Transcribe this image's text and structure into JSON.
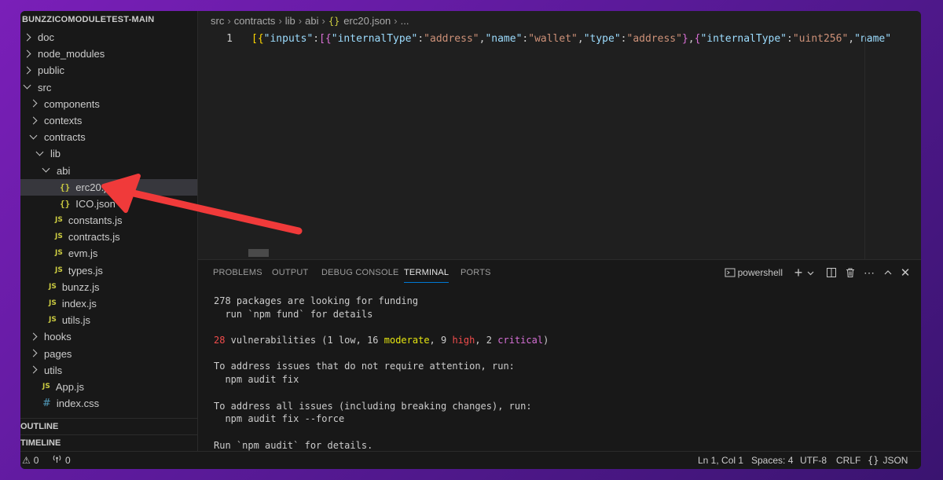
{
  "explorer": {
    "title": "BUNZZICOMODULETEST-MAIN"
  },
  "tree": [
    {
      "label": "doc",
      "type": "folder",
      "state": "collapsed",
      "depth": 0
    },
    {
      "label": "node_modules",
      "type": "folder",
      "state": "collapsed",
      "depth": 0
    },
    {
      "label": "public",
      "type": "folder",
      "state": "collapsed",
      "depth": 0
    },
    {
      "label": "src",
      "type": "folder",
      "state": "expanded",
      "depth": 0
    },
    {
      "label": "components",
      "type": "folder",
      "state": "collapsed",
      "depth": 1
    },
    {
      "label": "contexts",
      "type": "folder",
      "state": "collapsed",
      "depth": 1
    },
    {
      "label": "contracts",
      "type": "folder",
      "state": "expanded",
      "depth": 1
    },
    {
      "label": "lib",
      "type": "folder",
      "state": "expanded",
      "depth": 2
    },
    {
      "label": "abi",
      "type": "folder",
      "state": "expanded",
      "depth": 3
    },
    {
      "label": "erc20.json",
      "type": "json",
      "depth": 4,
      "selected": true
    },
    {
      "label": "ICO.json",
      "type": "json",
      "depth": 4
    },
    {
      "label": "constants.js",
      "type": "js",
      "depth": 3
    },
    {
      "label": "contracts.js",
      "type": "js",
      "depth": 3
    },
    {
      "label": "evm.js",
      "type": "js",
      "depth": 3
    },
    {
      "label": "types.js",
      "type": "js",
      "depth": 3
    },
    {
      "label": "bunzz.js",
      "type": "js",
      "depth": 2
    },
    {
      "label": "index.js",
      "type": "js",
      "depth": 2
    },
    {
      "label": "utils.js",
      "type": "js",
      "depth": 2
    },
    {
      "label": "hooks",
      "type": "folder",
      "state": "collapsed",
      "depth": 1
    },
    {
      "label": "pages",
      "type": "folder",
      "state": "collapsed",
      "depth": 1
    },
    {
      "label": "utils",
      "type": "folder",
      "state": "collapsed",
      "depth": 1
    },
    {
      "label": "App.js",
      "type": "js",
      "depth": 1
    },
    {
      "label": "index.css",
      "type": "css",
      "depth": 1
    }
  ],
  "icons": {
    "js": "JS",
    "json": "{}",
    "css": "#"
  },
  "sections": {
    "outline": "OUTLINE",
    "timeline": "TIMELINE"
  },
  "breadcrumb": {
    "parts": [
      "src",
      "contracts",
      "lib",
      "abi"
    ],
    "file": "erc20.json",
    "more": "..."
  },
  "editor": {
    "line_number": "1",
    "tokens": [
      [
        "br",
        "[{"
      ],
      [
        "key",
        "\"inputs\""
      ],
      [
        "p",
        ":"
      ],
      [
        "br2",
        "[{"
      ],
      [
        "key",
        "\"internalType\""
      ],
      [
        "p",
        ":"
      ],
      [
        "str",
        "\"address\""
      ],
      [
        "p",
        ","
      ],
      [
        "key",
        "\"name\""
      ],
      [
        "p",
        ":"
      ],
      [
        "str",
        "\"wallet\""
      ],
      [
        "p",
        ","
      ],
      [
        "key",
        "\"type\""
      ],
      [
        "p",
        ":"
      ],
      [
        "str",
        "\"address\""
      ],
      [
        "br2",
        "}"
      ],
      [
        "p",
        ","
      ],
      [
        "br2",
        "{"
      ],
      [
        "key",
        "\"internalType\""
      ],
      [
        "p",
        ":"
      ],
      [
        "str",
        "\"uint256\""
      ],
      [
        "p",
        ","
      ],
      [
        "key",
        "\"name\""
      ],
      [
        "p",
        ":"
      ],
      [
        "str",
        "\""
      ]
    ]
  },
  "panel": {
    "tabs": [
      "PROBLEMS",
      "OUTPUT",
      "DEBUG CONSOLE",
      "TERMINAL",
      "PORTS"
    ],
    "active_tab": "TERMINAL",
    "shell": "powershell"
  },
  "terminal": {
    "lines": [
      [
        [
          "n",
          "278 packages are looking for funding"
        ]
      ],
      [
        [
          "n",
          "  run `npm fund` for details"
        ]
      ],
      [],
      [
        [
          "red",
          "28"
        ],
        [
          "n",
          " vulnerabilities (1 low, 16 "
        ],
        [
          "yellow",
          "moderate"
        ],
        [
          "n",
          ", 9 "
        ],
        [
          "red",
          "high"
        ],
        [
          "n",
          ", 2 "
        ],
        [
          "magenta",
          "critical"
        ],
        [
          "n",
          ")"
        ]
      ],
      [],
      [
        [
          "n",
          "To address issues that do not require attention, run:"
        ]
      ],
      [
        [
          "n",
          "  npm audit fix"
        ]
      ],
      [],
      [
        [
          "n",
          "To address all issues (including breaking changes), run:"
        ]
      ],
      [
        [
          "n",
          "  npm audit fix --force"
        ]
      ],
      [],
      [
        [
          "n",
          "Run `npm audit` for details."
        ]
      ]
    ]
  },
  "statusbar": {
    "errors": "0",
    "ports": "0",
    "position": "Ln 1, Col 1",
    "spaces": "Spaces: 4",
    "encoding": "UTF-8",
    "eol": "CRLF",
    "language": "JSON",
    "language_icon": "{}"
  },
  "colors": {
    "background_gradient": [
      "#7a1fb8",
      "#3a1470"
    ],
    "arrow": "#f03a3a",
    "accent": "#0078d4"
  }
}
